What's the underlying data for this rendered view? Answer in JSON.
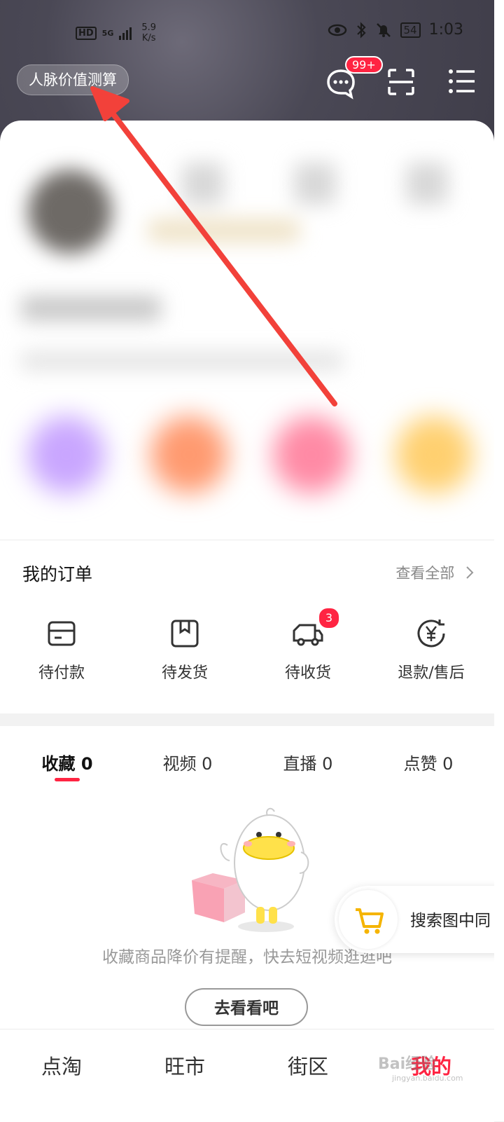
{
  "status_bar": {
    "hd": "HD",
    "network": "5G",
    "speed_value": "5.9",
    "speed_unit": "K/s",
    "battery": "54",
    "time": "1:03"
  },
  "header": {
    "network_calc_label": "人脉价值测算",
    "message_badge": "99+"
  },
  "orders": {
    "title": "我的订单",
    "view_all": "查看全部",
    "items": [
      {
        "label": "待付款"
      },
      {
        "label": "待发货"
      },
      {
        "label": "待收货",
        "badge": "3"
      },
      {
        "label": "退款/售后"
      }
    ]
  },
  "favorites": {
    "tabs": [
      {
        "label": "收藏 0"
      },
      {
        "label": "视频 0"
      },
      {
        "label": "直播 0"
      },
      {
        "label": "点赞 0"
      }
    ],
    "empty_text": "收藏商品降价有提醒，快去短视频逛逛吧",
    "go_button": "去看看吧"
  },
  "float_search": {
    "label": "搜索图中同"
  },
  "tabbar": {
    "items": [
      {
        "label": "点淘"
      },
      {
        "label": "旺市"
      },
      {
        "label": "街区"
      },
      {
        "label": "我的"
      }
    ]
  },
  "watermark": {
    "text": "Bai经验",
    "sub": "jingyan.baidu.com"
  },
  "colors": {
    "accent": "#ff2442",
    "header_bg": "#4a4855",
    "annotation_arrow": "#f2413a"
  }
}
